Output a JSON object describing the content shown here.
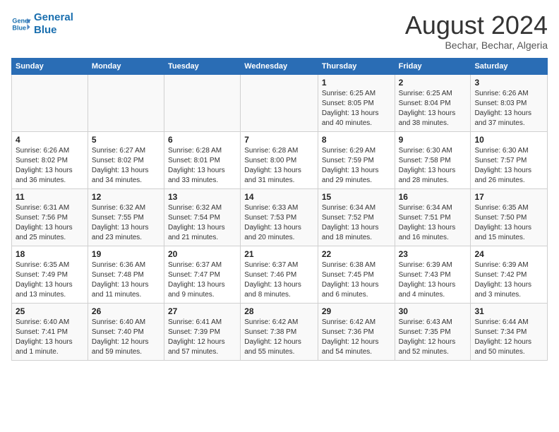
{
  "header": {
    "logo_line1": "General",
    "logo_line2": "Blue",
    "main_title": "August 2024",
    "subtitle": "Bechar, Bechar, Algeria"
  },
  "days_of_week": [
    "Sunday",
    "Monday",
    "Tuesday",
    "Wednesday",
    "Thursday",
    "Friday",
    "Saturday"
  ],
  "weeks": [
    [
      {
        "num": "",
        "info": ""
      },
      {
        "num": "",
        "info": ""
      },
      {
        "num": "",
        "info": ""
      },
      {
        "num": "",
        "info": ""
      },
      {
        "num": "1",
        "info": "Sunrise: 6:25 AM\nSunset: 8:05 PM\nDaylight: 13 hours\nand 40 minutes."
      },
      {
        "num": "2",
        "info": "Sunrise: 6:25 AM\nSunset: 8:04 PM\nDaylight: 13 hours\nand 38 minutes."
      },
      {
        "num": "3",
        "info": "Sunrise: 6:26 AM\nSunset: 8:03 PM\nDaylight: 13 hours\nand 37 minutes."
      }
    ],
    [
      {
        "num": "4",
        "info": "Sunrise: 6:26 AM\nSunset: 8:02 PM\nDaylight: 13 hours\nand 36 minutes."
      },
      {
        "num": "5",
        "info": "Sunrise: 6:27 AM\nSunset: 8:02 PM\nDaylight: 13 hours\nand 34 minutes."
      },
      {
        "num": "6",
        "info": "Sunrise: 6:28 AM\nSunset: 8:01 PM\nDaylight: 13 hours\nand 33 minutes."
      },
      {
        "num": "7",
        "info": "Sunrise: 6:28 AM\nSunset: 8:00 PM\nDaylight: 13 hours\nand 31 minutes."
      },
      {
        "num": "8",
        "info": "Sunrise: 6:29 AM\nSunset: 7:59 PM\nDaylight: 13 hours\nand 29 minutes."
      },
      {
        "num": "9",
        "info": "Sunrise: 6:30 AM\nSunset: 7:58 PM\nDaylight: 13 hours\nand 28 minutes."
      },
      {
        "num": "10",
        "info": "Sunrise: 6:30 AM\nSunset: 7:57 PM\nDaylight: 13 hours\nand 26 minutes."
      }
    ],
    [
      {
        "num": "11",
        "info": "Sunrise: 6:31 AM\nSunset: 7:56 PM\nDaylight: 13 hours\nand 25 minutes."
      },
      {
        "num": "12",
        "info": "Sunrise: 6:32 AM\nSunset: 7:55 PM\nDaylight: 13 hours\nand 23 minutes."
      },
      {
        "num": "13",
        "info": "Sunrise: 6:32 AM\nSunset: 7:54 PM\nDaylight: 13 hours\nand 21 minutes."
      },
      {
        "num": "14",
        "info": "Sunrise: 6:33 AM\nSunset: 7:53 PM\nDaylight: 13 hours\nand 20 minutes."
      },
      {
        "num": "15",
        "info": "Sunrise: 6:34 AM\nSunset: 7:52 PM\nDaylight: 13 hours\nand 18 minutes."
      },
      {
        "num": "16",
        "info": "Sunrise: 6:34 AM\nSunset: 7:51 PM\nDaylight: 13 hours\nand 16 minutes."
      },
      {
        "num": "17",
        "info": "Sunrise: 6:35 AM\nSunset: 7:50 PM\nDaylight: 13 hours\nand 15 minutes."
      }
    ],
    [
      {
        "num": "18",
        "info": "Sunrise: 6:35 AM\nSunset: 7:49 PM\nDaylight: 13 hours\nand 13 minutes."
      },
      {
        "num": "19",
        "info": "Sunrise: 6:36 AM\nSunset: 7:48 PM\nDaylight: 13 hours\nand 11 minutes."
      },
      {
        "num": "20",
        "info": "Sunrise: 6:37 AM\nSunset: 7:47 PM\nDaylight: 13 hours\nand 9 minutes."
      },
      {
        "num": "21",
        "info": "Sunrise: 6:37 AM\nSunset: 7:46 PM\nDaylight: 13 hours\nand 8 minutes."
      },
      {
        "num": "22",
        "info": "Sunrise: 6:38 AM\nSunset: 7:45 PM\nDaylight: 13 hours\nand 6 minutes."
      },
      {
        "num": "23",
        "info": "Sunrise: 6:39 AM\nSunset: 7:43 PM\nDaylight: 13 hours\nand 4 minutes."
      },
      {
        "num": "24",
        "info": "Sunrise: 6:39 AM\nSunset: 7:42 PM\nDaylight: 13 hours\nand 3 minutes."
      }
    ],
    [
      {
        "num": "25",
        "info": "Sunrise: 6:40 AM\nSunset: 7:41 PM\nDaylight: 13 hours\nand 1 minute."
      },
      {
        "num": "26",
        "info": "Sunrise: 6:40 AM\nSunset: 7:40 PM\nDaylight: 12 hours\nand 59 minutes."
      },
      {
        "num": "27",
        "info": "Sunrise: 6:41 AM\nSunset: 7:39 PM\nDaylight: 12 hours\nand 57 minutes."
      },
      {
        "num": "28",
        "info": "Sunrise: 6:42 AM\nSunset: 7:38 PM\nDaylight: 12 hours\nand 55 minutes."
      },
      {
        "num": "29",
        "info": "Sunrise: 6:42 AM\nSunset: 7:36 PM\nDaylight: 12 hours\nand 54 minutes."
      },
      {
        "num": "30",
        "info": "Sunrise: 6:43 AM\nSunset: 7:35 PM\nDaylight: 12 hours\nand 52 minutes."
      },
      {
        "num": "31",
        "info": "Sunrise: 6:44 AM\nSunset: 7:34 PM\nDaylight: 12 hours\nand 50 minutes."
      }
    ]
  ]
}
